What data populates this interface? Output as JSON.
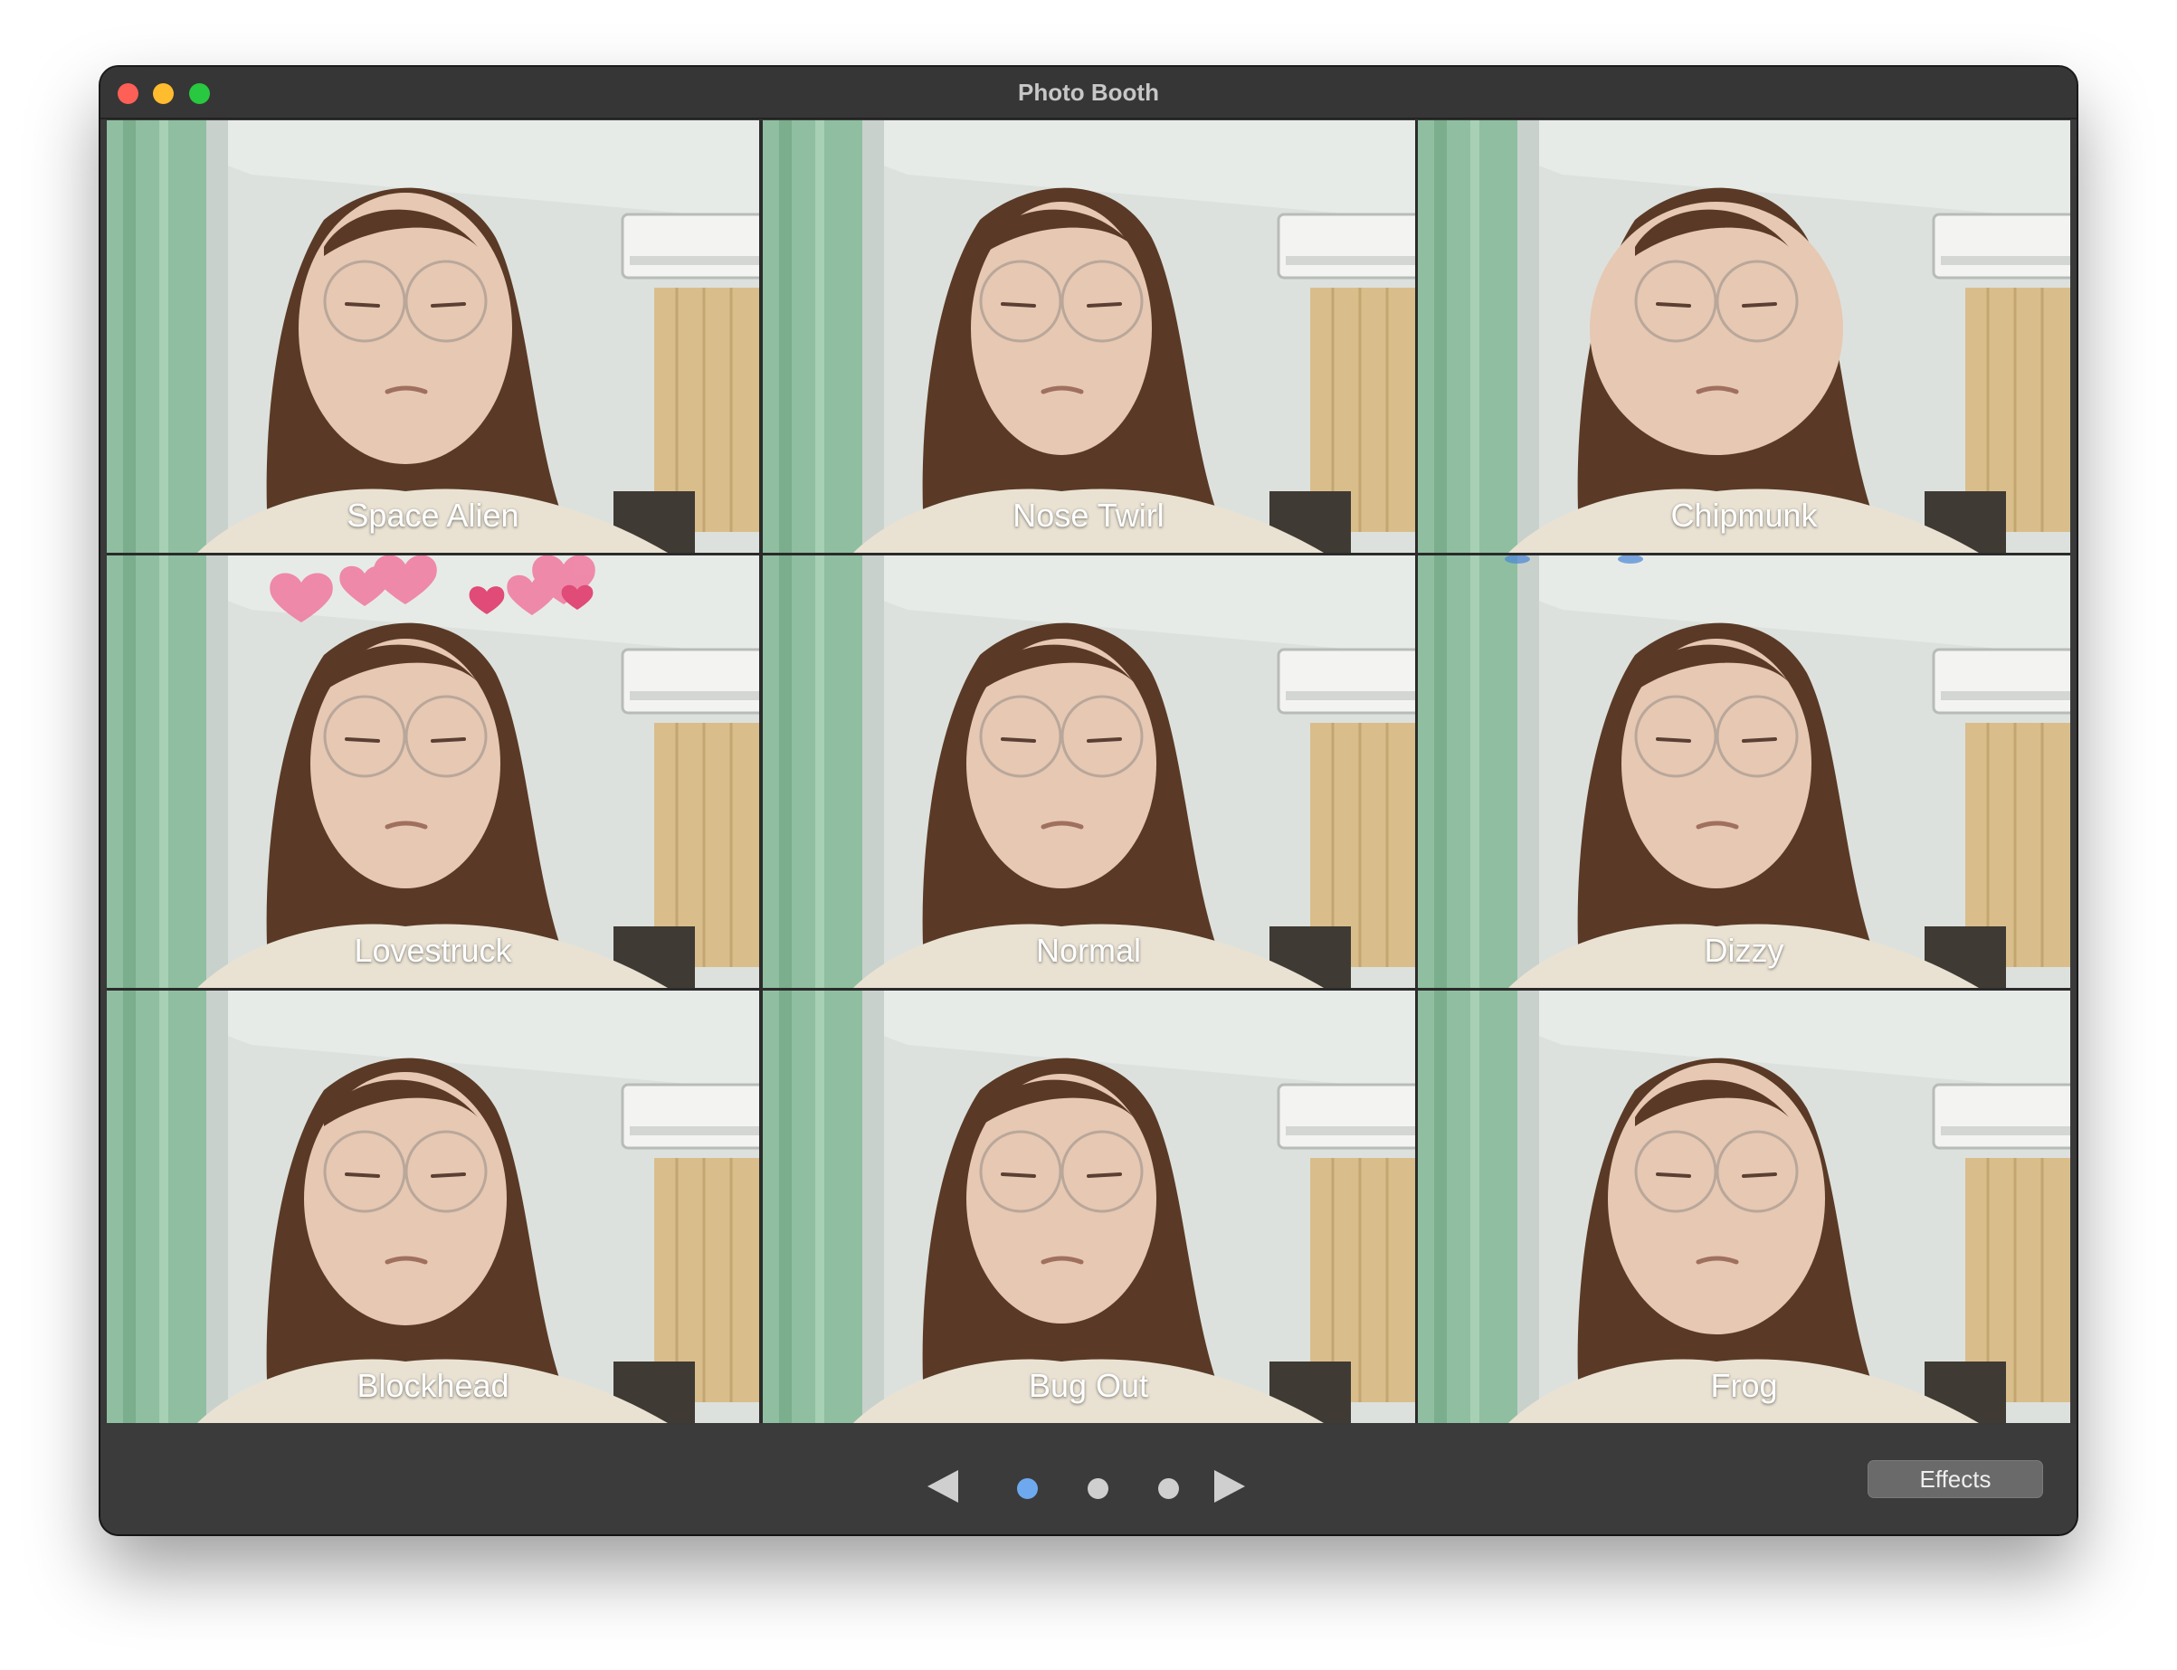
{
  "window": {
    "title": "Photo Booth"
  },
  "traffic_lights": [
    "close-button",
    "minimize-button",
    "zoom-button"
  ],
  "effects": [
    {
      "label": "Space Alien",
      "decoration": "none"
    },
    {
      "label": "Nose Twirl",
      "decoration": "none"
    },
    {
      "label": "Chipmunk",
      "decoration": "none"
    },
    {
      "label": "Lovestruck",
      "decoration": "hearts"
    },
    {
      "label": "Normal",
      "decoration": "none"
    },
    {
      "label": "Dizzy",
      "decoration": "birds"
    },
    {
      "label": "Blockhead",
      "decoration": "none"
    },
    {
      "label": "Bug Out",
      "decoration": "none"
    },
    {
      "label": "Frog",
      "decoration": "none"
    }
  ],
  "pagination": {
    "pages": 3,
    "current": 1
  },
  "buttons": {
    "effects_label": "Effects"
  },
  "colors": {
    "accent_dot": "#6ea9f0",
    "curtain_green": "#8fbfa0",
    "blind_tan": "#d9be8b",
    "hair": "#5a3a26"
  },
  "icons": {
    "prev": "triangle-left-icon",
    "next": "triangle-right-icon"
  }
}
